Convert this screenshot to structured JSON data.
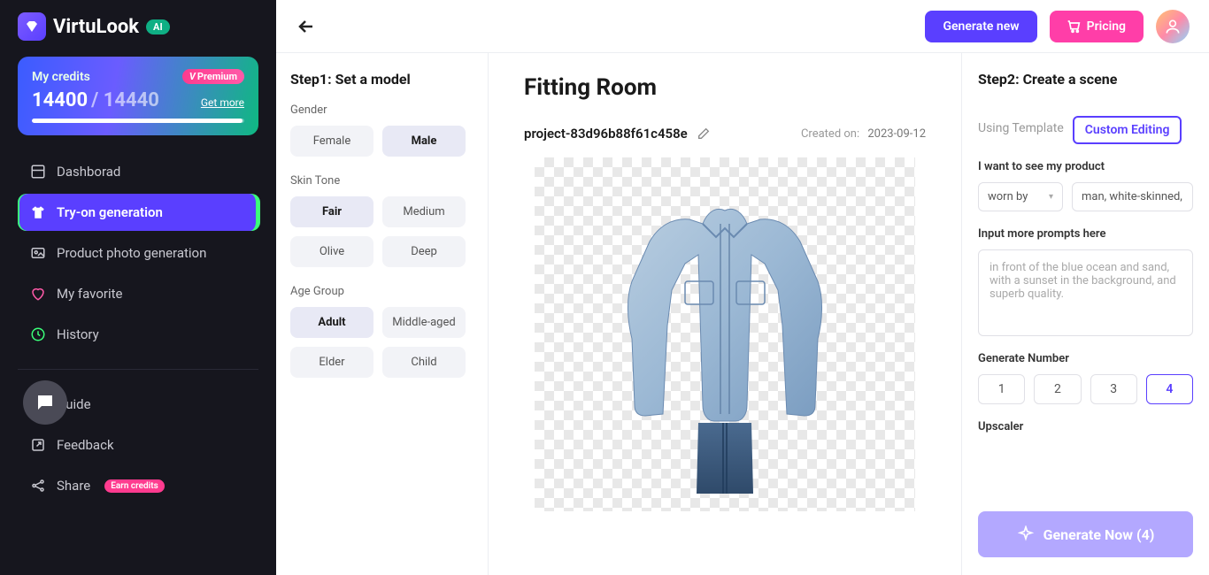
{
  "brand": {
    "name": "VirtuLook",
    "ai_badge": "AI"
  },
  "credits": {
    "label": "My credits",
    "premium": "Premium",
    "current": "14400",
    "total": "14440",
    "get_more": "Get more"
  },
  "nav": {
    "dashboard": "Dashborad",
    "tryon": "Try-on generation",
    "product": "Product photo generation",
    "favorite": "My favorite",
    "history": "History",
    "guide": "Guide",
    "feedback": "Feedback",
    "share": "Share",
    "share_badge": "Earn credits"
  },
  "topbar": {
    "generate_new": "Generate new",
    "pricing": "Pricing"
  },
  "step1": {
    "title": "Step1: Set a model",
    "gender": {
      "label": "Gender",
      "options": [
        "Female",
        "Male"
      ],
      "selected": "Male"
    },
    "skin": {
      "label": "Skin Tone",
      "options": [
        "Fair",
        "Medium",
        "Olive",
        "Deep"
      ],
      "selected": "Fair"
    },
    "age": {
      "label": "Age Group",
      "options": [
        "Adult",
        "Middle-aged",
        "Elder",
        "Child"
      ],
      "selected": "Adult"
    }
  },
  "center": {
    "title": "Fitting Room",
    "project_name": "project-83d96b88f61c458e",
    "created_label": "Created on:",
    "created_date": "2023-09-12"
  },
  "step2": {
    "title": "Step2: Create a scene",
    "tabs": {
      "template": "Using Template",
      "custom": "Custom Editing"
    },
    "see_label": "I want to see my product",
    "worn_by": "worn by",
    "model_desc": "man, white-skinned,",
    "prompt_label": "Input more prompts here",
    "prompt_placeholder": "in front of the blue ocean and sand, with a sunset in the background, and superb quality.",
    "gen_num_label": "Generate Number",
    "gen_nums": [
      "1",
      "2",
      "3",
      "4"
    ],
    "upscaler_label": "Upscaler",
    "generate_btn": "Generate Now (4)"
  }
}
